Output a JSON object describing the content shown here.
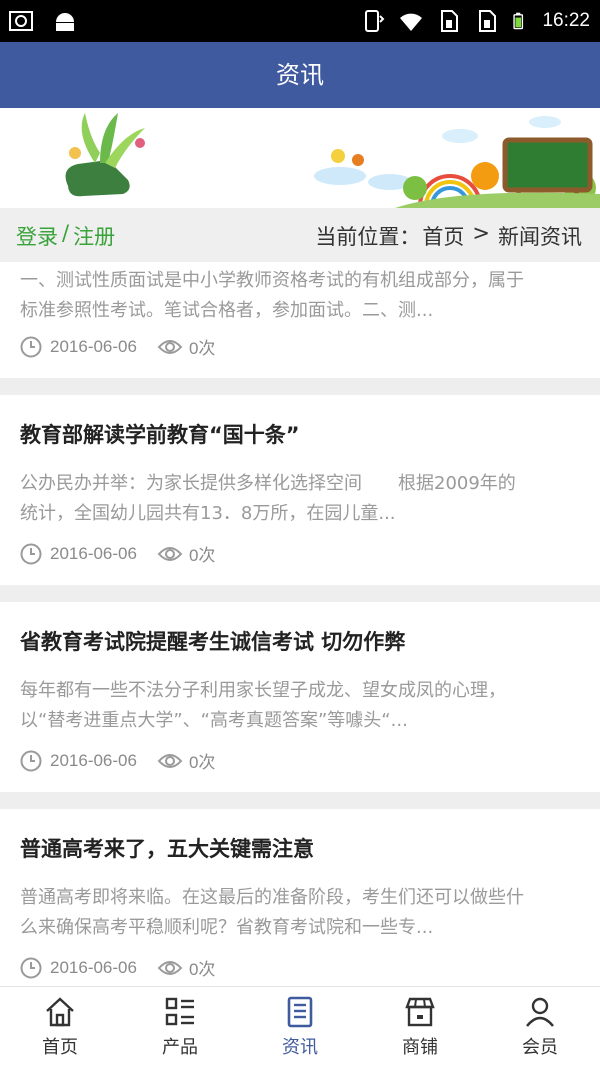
{
  "status_bar": {
    "time": "16:22",
    "left_icons": [
      "screenshot-icon",
      "android-icon"
    ],
    "right_icons": [
      "phone-vibrate-icon",
      "wifi-icon",
      "sim1-icon",
      "sim2-icon",
      "battery-icon"
    ]
  },
  "header": {
    "title": "资讯"
  },
  "breadcrumb": {
    "login": "登录",
    "separator": "/",
    "register": "注册",
    "location_label": "当前位置：",
    "home": "首页",
    "arrow": ">",
    "current": "新闻资讯"
  },
  "articles": [
    {
      "title": "",
      "summary_line1": "一、测试性质面试是中小学教师资格考试的有机组成部分，属于",
      "summary_line2": "标准参照性考试。笔试合格者，参加面试。二、测...",
      "date": "2016-06-06",
      "views": "0次"
    },
    {
      "title": "教育部解读学前教育“国十条”",
      "summary_line1": "公办民办并举：为家长提供多样化选择空间　　根据2009年的",
      "summary_line2": "统计，全国幼儿园共有13．8万所，在园儿童...",
      "date": "2016-06-06",
      "views": "0次"
    },
    {
      "title": "省教育考试院提醒考生诚信考试 切勿作弊",
      "summary_line1": "每年都有一些不法分子利用家长望子成龙、望女成凤的心理，",
      "summary_line2": "以“替考进重点大学”、“高考真题答案”等噱头“...",
      "date": "2016-06-06",
      "views": "0次"
    },
    {
      "title": "普通高考来了，五大关键需注意",
      "summary_line1": "普通高考即将来临。在这最后的准备阶段，考生们还可以做些什",
      "summary_line2": "么来确保高考平稳顺利呢？省教育考试院和一些专...",
      "date": "2016-06-06",
      "views": "0次"
    }
  ],
  "tabbar": {
    "items": [
      {
        "label": "首页",
        "icon": "home-icon",
        "active": false
      },
      {
        "label": "产品",
        "icon": "grid-list-icon",
        "active": false
      },
      {
        "label": "资讯",
        "icon": "document-icon",
        "active": true
      },
      {
        "label": "商铺",
        "icon": "store-icon",
        "active": false
      },
      {
        "label": "会员",
        "icon": "user-icon",
        "active": false
      }
    ]
  },
  "colors": {
    "header_bg": "#3f5a9e",
    "accent_green": "#39a33a",
    "active_tab": "#3f5a9e"
  }
}
